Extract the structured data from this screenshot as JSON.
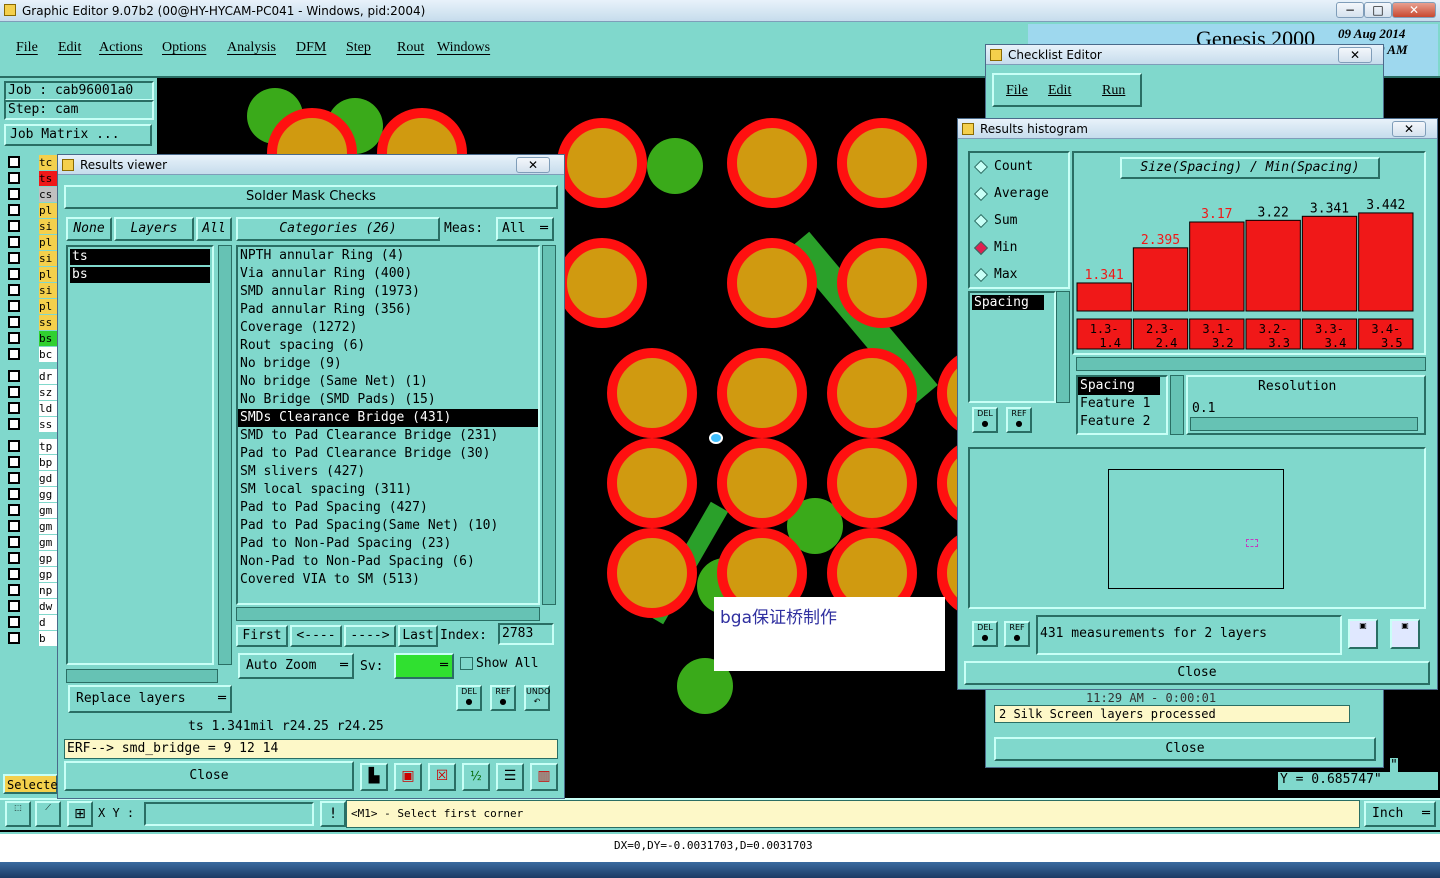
{
  "app": {
    "title": "Graphic Editor 9.07b2 (00@HY-HYCAM-PC041 - Windows, pid:2004)",
    "brand": "Genesis 2000",
    "date": "09 Aug 2014",
    "time": "0 AM",
    "menu": [
      "File",
      "Edit",
      "Actions",
      "Options",
      "Analysis",
      "DFM",
      "Step",
      "Rout",
      "Windows"
    ],
    "job_label": "Job  : cab96001a0",
    "step_label": "Step: cam",
    "job_matrix": "Job Matrix ...",
    "select_btn": "Selecte",
    "layer_rows": [
      "tc",
      "ts",
      "cs",
      "pl",
      "si",
      "pl",
      "si",
      "pl",
      "si",
      "pl",
      "ss",
      "bs",
      "bc",
      "dr",
      "sz",
      "ld",
      "ss",
      "tp",
      "bp",
      "gd",
      "gg",
      "gm",
      "gm",
      "gm",
      "gp",
      "gp",
      "np",
      "dw",
      "d",
      "b"
    ],
    "coords_x": "\"",
    "coords_y": "Y = 0.685747\"",
    "xy_label": "X Y :",
    "status_msg": "<M1> - Select first corner",
    "unit": "Inch",
    "bottom_status": "DX=0,DY=-0.0031703,D=0.0031703",
    "canvas_note": "bga保证桥制作"
  },
  "results_viewer": {
    "title": "Results viewer",
    "header": "Solder Mask Checks",
    "none_btn": "None",
    "layers_btn": "Layers",
    "all_btn": "All",
    "layers": [
      "ts",
      "bs"
    ],
    "categories_btn": "Categories (26)",
    "meas_label": "Meas:",
    "meas_value": "All",
    "categories": [
      "NPTH annular Ring (4)",
      "Via annular Ring (400)",
      "SMD annular Ring (1973)",
      "Pad annular Ring (356)",
      "Coverage (1272)",
      "Rout spacing (6)",
      "No bridge (9)",
      "No bridge (Same Net) (1)",
      "No Bridge (SMD Pads) (15)",
      "SMDs Clearance Bridge (431)",
      "SMD to Pad Clearance Bridge (231)",
      "Pad to Pad Clearance Bridge (30)",
      "SM slivers (427)",
      "SM local spacing (311)",
      "Pad to Pad Spacing (427)",
      "Pad to Pad Spacing(Same Net) (10)",
      "Pad to Non-Pad Spacing (23)",
      "Non-Pad to Non-Pad Spacing (6)",
      "Covered VIA to SM (513)"
    ],
    "selected_index": 9,
    "first_btn": "First",
    "prev_btn": "<----",
    "next_btn": "---->",
    "last_btn": "Last",
    "index_label": "Index:",
    "index_value": "2783",
    "auto_zoom": "Auto Zoom",
    "sv_label": "Sv:",
    "show_all": "Show All",
    "replace_layers": "Replace layers",
    "del": "DEL",
    "ref": "REF",
    "undo": "UNDO",
    "info_line": "ts 1.341mil  r24.25  r24.25",
    "erf_line": "ERF--> smd_bridge = 9 12 14",
    "close": "Close"
  },
  "checklist_editor": {
    "title": "Checklist Editor",
    "menu": [
      "File",
      "Edit",
      "Run"
    ],
    "processed": "2 Silk Screen layers processed",
    "time_row": "11:29 AM - 0:00:01",
    "close": "Close"
  },
  "histogram": {
    "title": "Results histogram",
    "modes": [
      "Count",
      "Average",
      "Sum",
      "Min",
      "Max"
    ],
    "selected_mode": 3,
    "chart_title": "Size(Spacing) / Min(Spacing)",
    "left_list": [
      "Spacing"
    ],
    "feature_list": [
      "Spacing",
      "Feature 1",
      "Feature 2"
    ],
    "resolution_label": "Resolution",
    "resolution_value": "0.1",
    "measurements": "431 measurements for 2 layers",
    "close": "Close",
    "bar_color": "#f01818"
  },
  "chart_data": {
    "type": "bar",
    "title": "Size(Spacing) / Min(Spacing)",
    "categories": [
      "1.3-\n1.4",
      "2.3-\n2.4",
      "3.1-\n3.2",
      "3.2-\n3.3",
      "3.3-\n3.4",
      "3.4-\n3.5"
    ],
    "category_top": [
      "1.3-",
      "2.3-",
      "3.1-",
      "3.2-",
      "3.3-",
      "3.4-"
    ],
    "category_bottom": [
      "1.4",
      "2.4",
      "3.2",
      "3.3",
      "3.4",
      "3.5"
    ],
    "values": [
      1.341,
      2.395,
      3.17,
      3.22,
      3.341,
      3.442
    ],
    "value_labels": [
      "1.341",
      "2.395",
      "3.17",
      "3.22",
      "3.341",
      "3.442"
    ],
    "ylim": [
      0,
      3.8
    ]
  }
}
